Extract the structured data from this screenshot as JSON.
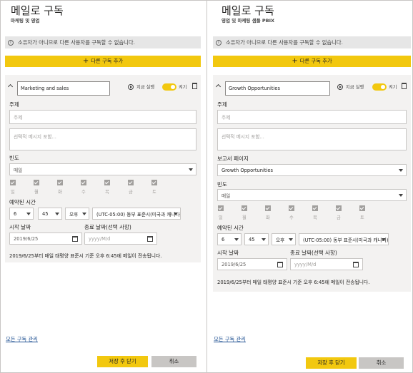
{
  "colors": {
    "accent": "#f2c80f",
    "card_bg": "#f3f2f1",
    "notice_bg": "#e6e6e6",
    "link": "#1d4f91",
    "cancel_bg": "#c8c6c4"
  },
  "icons": {
    "info": "info-icon",
    "plus": "plus-icon",
    "chevron": "chevron-up-icon",
    "run": "play-circle-icon",
    "delete": "trash-icon",
    "calendar": "calendar-icon",
    "checkbox": "checkbox-checked-icon"
  },
  "left": {
    "title": "메일로 구독",
    "subtitle": "마케팅 및 영업",
    "notice": "소유자가 아니므로 다른 사용자를 구독할 수 없습니다.",
    "add_button": "다른 구독 추가",
    "subscription_name": "Marketing and sales",
    "run_now": "지금 실행",
    "toggle_label": "켜기",
    "subject_label": "주제",
    "subject_placeholder": "주제",
    "message_placeholder": "선택적 메시지 포함...",
    "frequency_label": "빈도",
    "frequency_value": "매일",
    "days": [
      "일",
      "월",
      "화",
      "수",
      "목",
      "금",
      "토"
    ],
    "schedule_label": "예약된 시간",
    "hour": "6",
    "minute": "45",
    "ampm": "오후",
    "timezone": "(UTC-05:00) 동부 표준시(미국과 캐나다)",
    "start_label": "시작 날짜",
    "start_value": "2019/6/25",
    "end_label": "종료 날짜(선택 사항)",
    "end_placeholder": "yyyy/M/d",
    "summary": "2019/6/25부터 매일 태평양 표준시 기준 오후 6:45에 메일이 전송됩니다.",
    "manage_link": "모든 구독 관리",
    "save_button": "저장 후 닫기",
    "cancel_button": "취소"
  },
  "right": {
    "title": "메일로 구독",
    "subtitle": "영업 및 마케팅 샘플 PBIX",
    "notice": "소유자가 아니므로 다른 사용자를 구독할 수 없습니다.",
    "add_button": "다른 구독 추가",
    "subscription_name": "Growth Opportunities",
    "run_now": "지금 실행",
    "toggle_label": "켜기",
    "subject_label": "주제",
    "subject_placeholder": "주제",
    "message_placeholder": "선택적 메시지 포함...",
    "report_page_label": "보고서 페이지",
    "report_page_value": "Growth Opportunities",
    "frequency_label": "빈도",
    "frequency_value": "매일",
    "days": [
      "일",
      "월",
      "화",
      "수",
      "목",
      "금",
      "토"
    ],
    "schedule_label": "예약된 시간",
    "hour": "6",
    "minute": "45",
    "ampm": "오후",
    "timezone": "(UTC-05:00) 동부 표준시(미국과 캐나다)",
    "start_label": "시작 날짜",
    "start_value": "2019/6/25",
    "end_label": "종료 날짜(선택 사항)",
    "end_placeholder": "yyyy/M/d",
    "summary": "2019/6/25부터 매일 태평양 표준시 기준 오후 6:45에 메일이 전송됩니다.",
    "manage_link": "모든 구독 관리",
    "save_button": "저장 후 닫기",
    "cancel_button": "취소"
  }
}
